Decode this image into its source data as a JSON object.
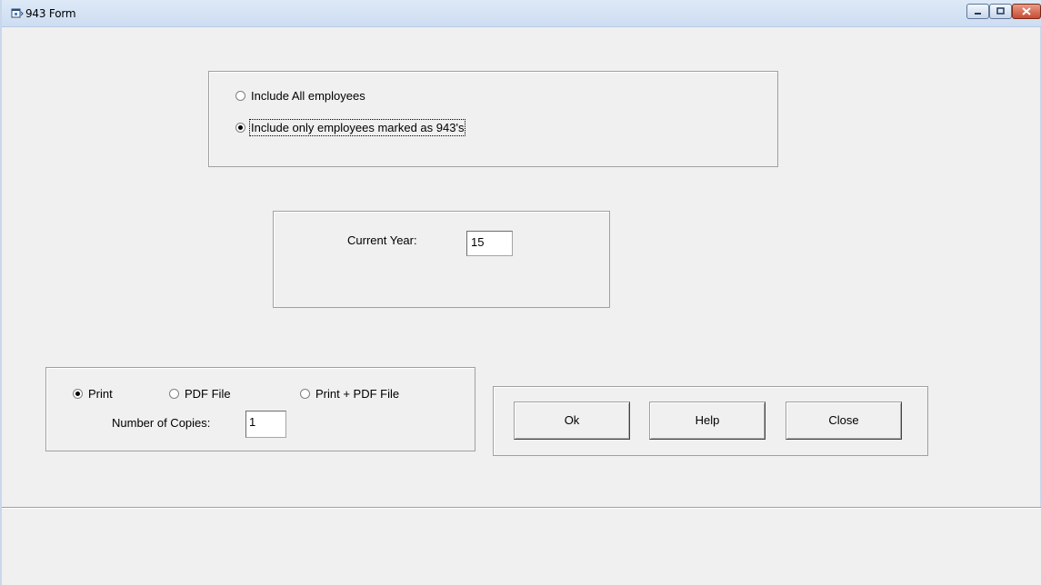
{
  "window": {
    "title": "943 Form",
    "title_icon": "app-window-icon",
    "controls": {
      "minimize_icon": "minimize-icon",
      "maximize_icon": "maximize-icon",
      "close_icon": "close-icon"
    }
  },
  "employee_filter": {
    "options": [
      {
        "label": "Include All employees",
        "selected": false
      },
      {
        "label": "Include only employees marked as 943's",
        "selected": true
      }
    ]
  },
  "year": {
    "label": "Current Year:",
    "value": "15"
  },
  "output": {
    "options": [
      {
        "label": "Print",
        "selected": true
      },
      {
        "label": "PDF File",
        "selected": false
      },
      {
        "label": "Print + PDF File",
        "selected": false
      }
    ],
    "copies_label": "Number of Copies:",
    "copies_value": "1"
  },
  "buttons": {
    "ok": "Ok",
    "help": "Help",
    "close": "Close"
  }
}
